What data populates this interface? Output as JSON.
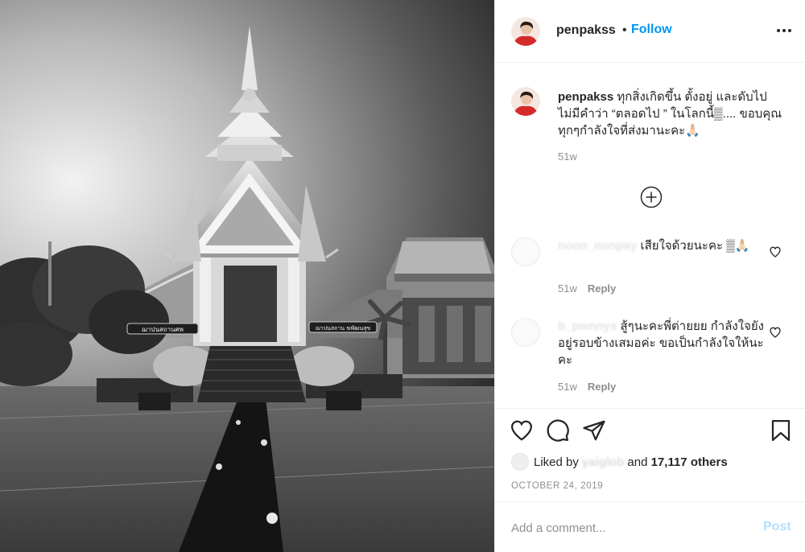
{
  "post": {
    "username": "penpakss",
    "follow_label": "Follow",
    "separator": "•",
    "more_icon": "more-horizontal-icon",
    "photo_alt": "Black and white photo of a Thai temple pavilion",
    "photo_signs": {
      "left": "ฌาปนสถานศพ",
      "right": "ฌาปนสถาน ฆพัฒนสุข"
    }
  },
  "caption": {
    "username": "penpakss",
    "text": " ทุกสิ่งเกิดขึ้น ตั้งอยู่ และดับไป ไม่มีคำว่า “ตลอดไป ” ในโลกนี้▒.... ขอบคุณทุกๆกำลังใจที่ส่งมานะคะ🙏🏻",
    "time": "51w"
  },
  "load_more_icon": "plus-circle-icon",
  "comments": [
    {
      "username": "noon_nonpay",
      "text": " เสียใจด้วยนะคะ ▒🙏🏻",
      "time": "51w",
      "reply_label": "Reply"
    },
    {
      "username": "b_pwnnys",
      "text": " สู้ๆนะคะพี่ต่ายยย กำลังใจยังอยู่รอบข้างเสมอค่ะ ขอเป็นกำลังใจให้นะคะ",
      "time": "51w",
      "reply_label": "Reply"
    }
  ],
  "actions": {
    "icons": [
      "heart-icon",
      "comment-icon",
      "share-icon",
      "bookmark-icon"
    ],
    "liked_prefix": "Liked by",
    "liked_user": "yaiglob",
    "liked_and": "and",
    "liked_count": "17,117 others",
    "date": "OCTOBER 24, 2019"
  },
  "add_comment": {
    "placeholder": "Add a comment...",
    "post_label": "Post"
  },
  "colors": {
    "follow": "#0095f6",
    "muted": "#8e8e8e",
    "post_disabled": "#b2dffc",
    "avatar_red": "#d42a2a"
  }
}
